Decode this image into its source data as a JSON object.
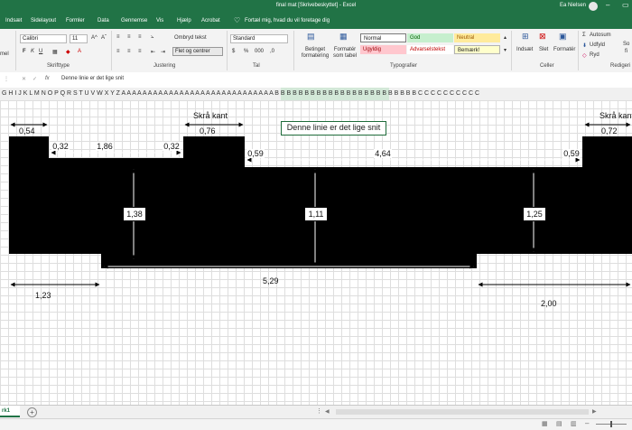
{
  "titlebar": {
    "title": "final mat  [Skrivebeskyttet]  -  Excel",
    "user": "Ea Nielsen"
  },
  "tabs": [
    "Indsæt",
    "Sidelayout",
    "Formler",
    "Data",
    "Gennemse",
    "Vis",
    "Hjælp",
    "Acrobat"
  ],
  "tell_me": "Fortæl mig, hvad du vil foretage dig",
  "ribbon": {
    "clipboard_tail": "mel",
    "font_name": "Calibri",
    "font_size": "11",
    "group_font": "Skrifttype",
    "wrap_text": "Ombryd tekst",
    "merge_center": "Flet og centrer",
    "group_alignment": "Justering",
    "number_format": "Standard",
    "group_number": "Tal",
    "cond_format": "Betinget formatering",
    "format_table": "Formatér som tabel",
    "styles": {
      "normal": "Normal",
      "good": "God",
      "neutral": "Neutral",
      "bad": "Ugyldig",
      "warning": "Advarselstekst",
      "note": "Bemærk!"
    },
    "group_styles": "Typografier",
    "insert": "Indsæt",
    "delete": "Slet",
    "format": "Formatér",
    "group_cells": "Celler",
    "autosum": "Autosum",
    "fill": "Udfyld",
    "clear": "Ryd",
    "group_editing": "Redigeri",
    "sort_tail": "So",
    "find_tail": "fi"
  },
  "formula_bar": {
    "fx": "fx",
    "content": "Denne linie er det lige snit"
  },
  "column_header": "G H I  J  K  L M N O P Q R S T U V W X Y Z A A A A A A A A A A A A A A A A A A A A A A A A A A A A A B B B B B B B B B B B B B B B B B B B B B B B B C C C C C C C C C C",
  "drawing": {
    "labels": {
      "slanted_left": "Skrå kant",
      "slanted_right": "Skrå kant",
      "straight_cut": "Denne linie er det lige snit"
    },
    "dims": [
      "0,54",
      "0,32",
      "1,86",
      "0,32",
      "0,76",
      "0,59",
      "4,64",
      "0,59",
      "0,72",
      "1,38",
      "1,11",
      "1,25",
      "1,23",
      "5,29",
      "2,00"
    ]
  },
  "sheet": {
    "tab": "rk1",
    "add": "+"
  },
  "colors": {
    "excel_green": "#217346",
    "good_bg": "#c6efce",
    "neutral_bg": "#ffeb9c",
    "bad_bg": "#ffc7ce",
    "cell_border": "#1e6b3a"
  }
}
